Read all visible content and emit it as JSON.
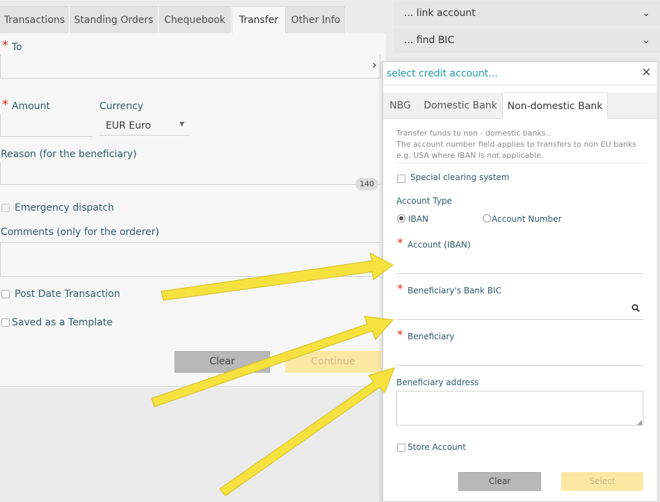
{
  "tabs": [
    "Transactions",
    "Standing Orders",
    "Chequebook",
    "Transfer",
    "Other Info"
  ],
  "form": {
    "to_label": "To",
    "amount_label": "Amount",
    "currency_label": "Currency",
    "currency_value": "EUR Euro",
    "reason_label": "Reason (for the beneficiary)",
    "reason_counter": "140",
    "emergency_label": "Emergency dispatch",
    "comments_label": "Comments (only for the orderer)",
    "post_date_label": "Post Date Transaction",
    "template_label": "Saved as a Template",
    "clear_label": "Clear",
    "continue_label": "Continue",
    "required_mark": "*"
  },
  "accordion": {
    "link_account": "... link account",
    "find_bic": "... find BIC"
  },
  "modal": {
    "title": "select credit account...",
    "close": "×",
    "tabs": [
      "NBG",
      "Domestic Bank",
      "Non-domestic Bank"
    ],
    "info_line1": "Transfer funds to non - domestic banks..",
    "info_line2": "The account number field applies to transfers to non EU banks",
    "info_line3": "e.g. USA where IBAN is not applicable.",
    "special_clearing": "Special clearing system",
    "account_type_label": "Account Type",
    "radio_iban": "IBAN",
    "radio_account_number": "Account Number",
    "account_iban_label": "Account (IBAN)",
    "bank_bic_label": "Beneficiary's Bank BIC",
    "beneficiary_label": "Beneficiary",
    "beneficiary_address_label": "Beneficiary address",
    "store_account_label": "Store Account",
    "clear_label": "Clear",
    "select_label": "Select"
  },
  "colors": {
    "accent_teal": "#1f9aa5",
    "required_red": "#e02b20",
    "disabled_yellow": "#fbe9a3",
    "annotation_arrow": "#f7e44a"
  }
}
